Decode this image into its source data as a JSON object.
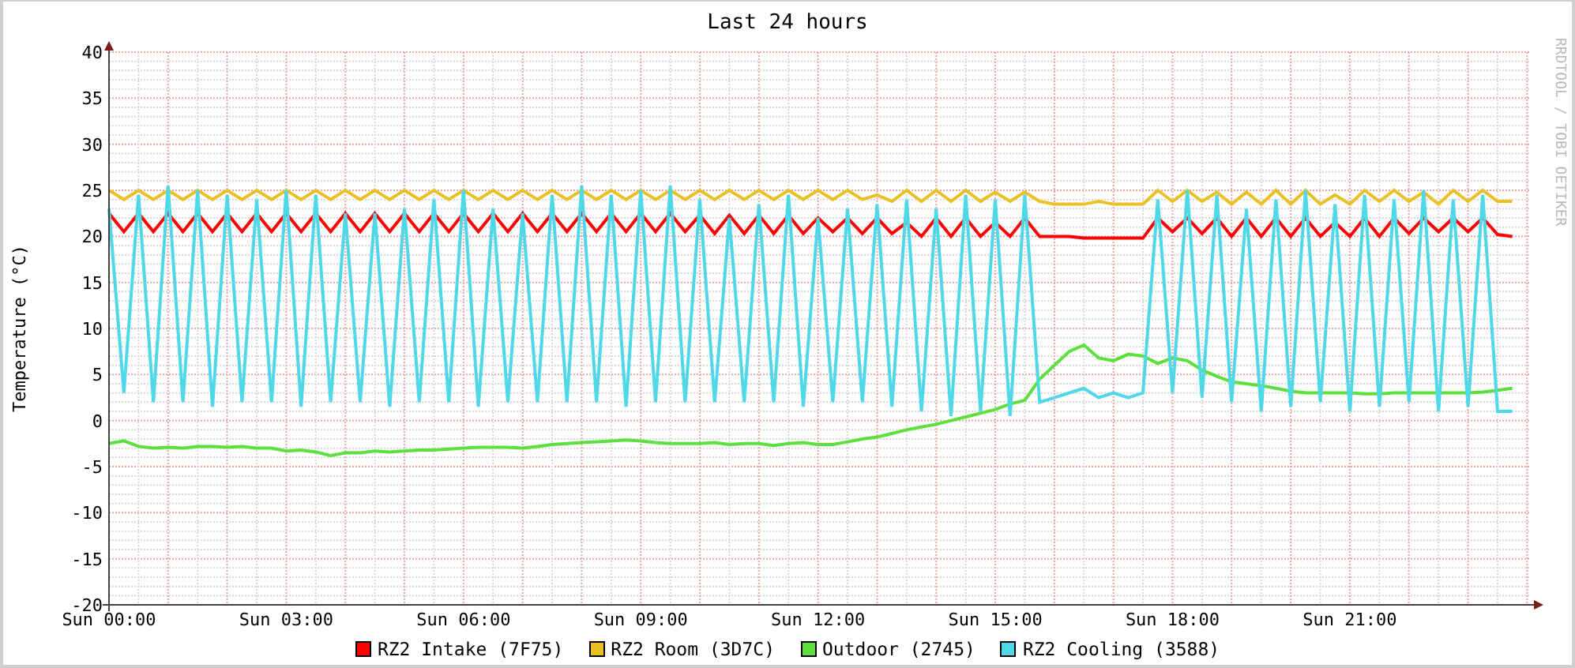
{
  "chart_data": {
    "type": "line",
    "title": "Last 24 hours",
    "ylabel": "Temperature (°C)",
    "categories": [
      "Sun 00:00",
      null,
      null,
      null,
      null,
      null,
      null,
      null,
      null,
      null,
      null,
      null,
      "Sun 03:00",
      null,
      null,
      null,
      null,
      null,
      null,
      null,
      null,
      null,
      null,
      null,
      "Sun 06:00",
      null,
      null,
      null,
      null,
      null,
      null,
      null,
      null,
      null,
      null,
      null,
      "Sun 09:00",
      null,
      null,
      null,
      null,
      null,
      null,
      null,
      null,
      null,
      null,
      null,
      "Sun 12:00",
      null,
      null,
      null,
      null,
      null,
      null,
      null,
      null,
      null,
      null,
      null,
      "Sun 15:00",
      null,
      null,
      null,
      null,
      null,
      null,
      null,
      null,
      null,
      null,
      null,
      "Sun 18:00",
      null,
      null,
      null,
      null,
      null,
      null,
      null,
      null,
      null,
      null,
      null,
      "Sun 21:00",
      null,
      null,
      null,
      null,
      null,
      null,
      null,
      null,
      null,
      null,
      null
    ],
    "ylim": [
      -20,
      40
    ],
    "grid": true,
    "yticks": [
      -20,
      -15,
      -10,
      -5,
      0,
      5,
      10,
      15,
      20,
      25,
      30,
      35,
      40
    ],
    "series": [
      {
        "name": "RZ2 Intake (7F75)",
        "color": "#ff0000",
        "values": [
          22.5,
          20.5,
          22.5,
          20.5,
          22.5,
          20.5,
          22.5,
          20.5,
          22.5,
          20.5,
          22.5,
          20.5,
          22.5,
          20.5,
          22.5,
          20.5,
          22.5,
          20.5,
          22.5,
          20.5,
          22.5,
          20.5,
          22.5,
          20.5,
          22.5,
          20.5,
          22.5,
          20.5,
          22.5,
          20.5,
          22.5,
          20.5,
          22.5,
          20.5,
          22.5,
          20.5,
          22.5,
          20.5,
          22.5,
          20.5,
          22.3,
          20.3,
          22.3,
          20.3,
          22.3,
          20.3,
          22.3,
          20.3,
          22,
          20.5,
          22,
          20.3,
          22,
          20.3,
          21.5,
          20,
          22,
          20,
          22,
          20,
          21.5,
          20,
          22,
          20,
          20,
          20,
          19.8,
          19.8,
          19.8,
          19.8,
          19.8,
          22,
          20.5,
          22,
          20.3,
          22,
          20,
          22,
          20,
          22,
          20,
          22,
          20,
          21.5,
          20,
          22,
          20,
          22,
          20.3,
          22,
          20.5,
          22,
          20.5,
          22,
          20.2,
          20
        ]
      },
      {
        "name": "RZ2 Room (3D7C)",
        "color": "#eac124",
        "values": [
          25,
          24,
          25,
          24,
          25,
          24,
          25,
          24,
          25,
          24,
          25,
          24,
          25,
          24,
          25,
          24,
          25,
          24,
          25,
          24,
          25,
          24,
          25,
          24,
          25,
          24,
          25,
          24,
          25,
          24,
          25,
          24,
          25,
          24,
          25,
          24,
          25,
          24,
          25,
          24,
          25,
          24,
          25,
          24,
          25,
          24,
          25,
          24,
          25,
          24,
          25,
          24,
          24.5,
          23.8,
          25,
          23.8,
          25,
          23.8,
          25,
          23.8,
          24.8,
          23.8,
          24.8,
          23.8,
          23.5,
          23.5,
          23.5,
          23.8,
          23.5,
          23.5,
          23.5,
          25,
          23.8,
          25,
          23.8,
          24.8,
          23.5,
          24.8,
          23.5,
          25,
          23.5,
          25,
          23.5,
          24.5,
          23.5,
          25,
          23.8,
          25,
          23.8,
          24.8,
          23.5,
          25,
          23.8,
          25,
          23.8,
          23.8
        ]
      },
      {
        "name": "Outdoor (2745)",
        "color": "#5ce13c",
        "values": [
          -2.5,
          -2.2,
          -2.8,
          -3,
          -2.9,
          -3,
          -2.8,
          -2.8,
          -2.9,
          -2.8,
          -3,
          -3,
          -3.3,
          -3.2,
          -3.4,
          -3.8,
          -3.5,
          -3.5,
          -3.3,
          -3.4,
          -3.3,
          -3.2,
          -3.2,
          -3.1,
          -3,
          -2.9,
          -2.9,
          -2.9,
          -3,
          -2.8,
          -2.6,
          -2.5,
          -2.4,
          -2.3,
          -2.2,
          -2.1,
          -2.2,
          -2.4,
          -2.5,
          -2.5,
          -2.5,
          -2.4,
          -2.6,
          -2.5,
          -2.5,
          -2.7,
          -2.5,
          -2.4,
          -2.6,
          -2.6,
          -2.3,
          -2,
          -1.8,
          -1.4,
          -1,
          -0.7,
          -0.4,
          0,
          0.4,
          0.8,
          1.2,
          1.8,
          2.2,
          4.5,
          6,
          7.5,
          8.2,
          6.8,
          6.5,
          7.2,
          7,
          6.2,
          6.8,
          6.5,
          5.5,
          4.8,
          4.2,
          4,
          3.8,
          3.5,
          3.2,
          3,
          3,
          3,
          3,
          2.9,
          2.9,
          3,
          3,
          3,
          3,
          3,
          3,
          3.1,
          3.3,
          3.5
        ]
      },
      {
        "name": "RZ2 Cooling (3588)",
        "color": "#4ed8e8",
        "values": [
          23,
          3,
          24.5,
          2,
          25.5,
          2,
          25,
          1.5,
          24.5,
          2,
          24,
          2,
          25,
          1.5,
          24.5,
          2,
          22.5,
          2,
          22.5,
          1.5,
          23,
          2,
          24,
          2,
          25,
          1.5,
          23,
          2,
          22.5,
          2,
          24.5,
          2,
          25.5,
          2,
          24.5,
          1.5,
          25,
          2,
          25.5,
          2,
          24,
          2,
          22,
          2,
          23.5,
          2,
          24.5,
          1.5,
          22,
          2,
          23,
          2,
          23.5,
          1.5,
          24,
          1,
          23,
          0.5,
          24.5,
          1,
          24,
          0.5,
          24.5,
          2,
          2.5,
          3,
          3.5,
          2.5,
          3,
          2.5,
          3,
          24,
          3,
          25,
          2.5,
          24.5,
          2,
          23,
          1,
          24,
          1.5,
          25,
          2,
          23.5,
          1,
          24.5,
          1.5,
          24,
          2,
          25,
          1,
          24,
          1.5,
          24.5,
          1,
          1
        ]
      }
    ]
  },
  "watermark": "RRDTOOL / TOBI OETIKER"
}
